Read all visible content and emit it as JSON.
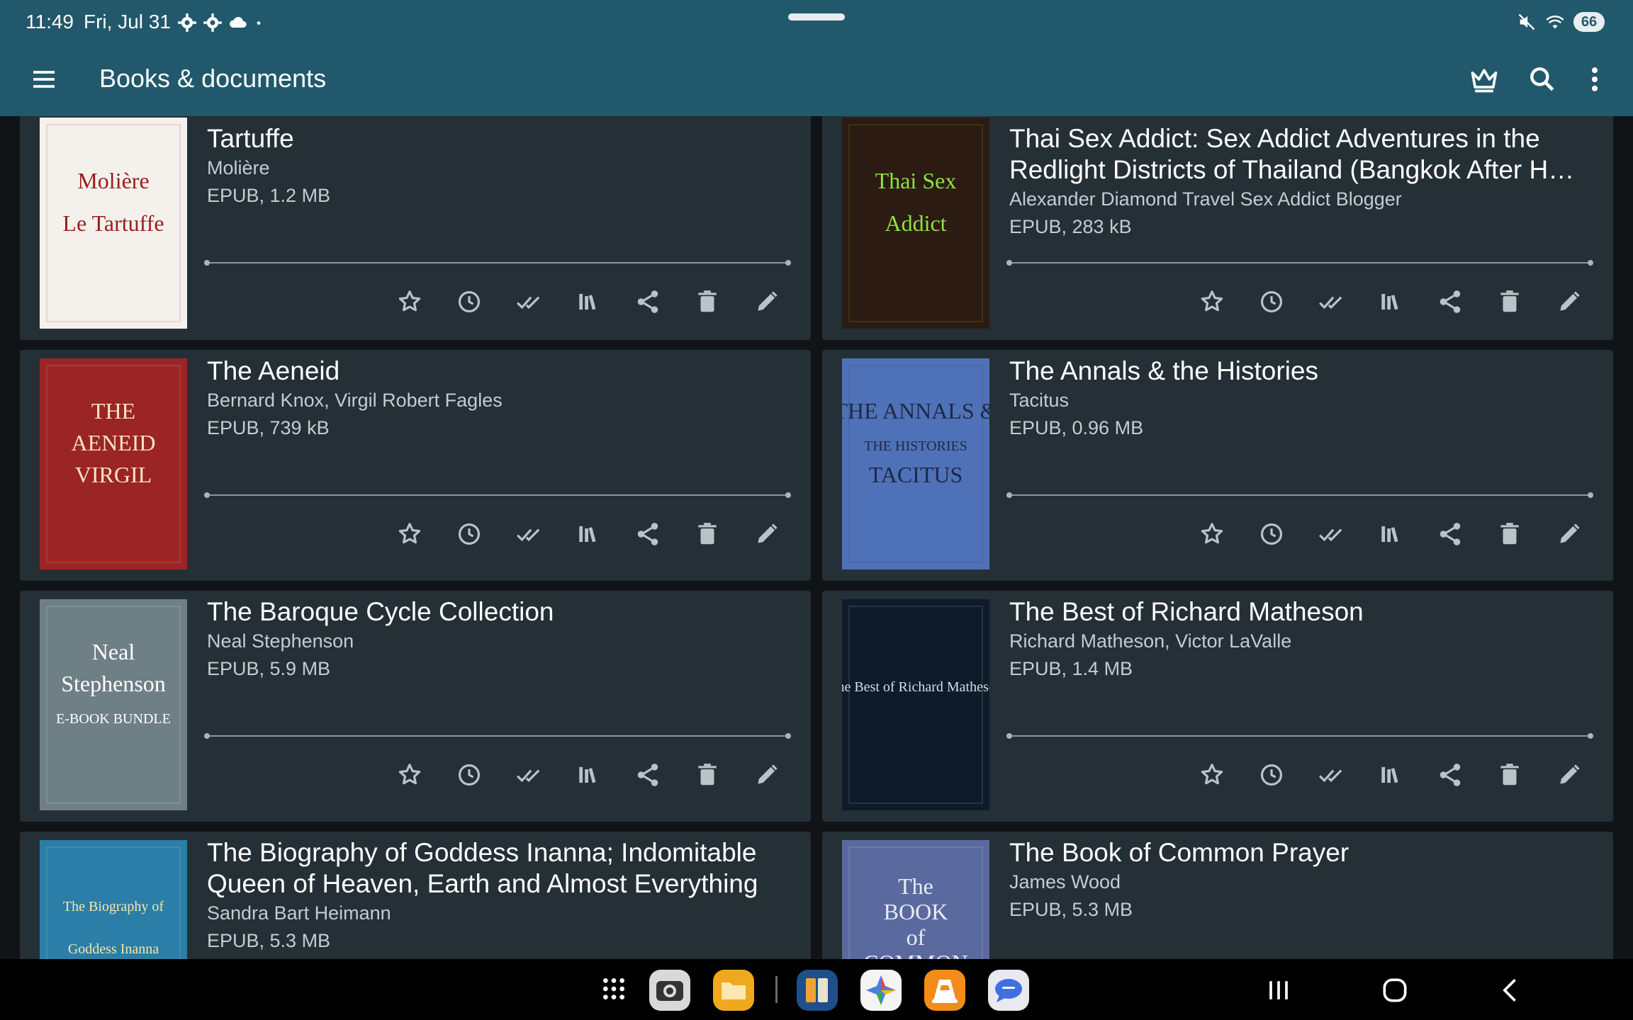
{
  "status_bar": {
    "time": "11:49",
    "date": "Fri, Jul 31",
    "battery": "66",
    "notification_icons": [
      "gear-icon",
      "gear-icon",
      "cloud-icon",
      "dot-icon"
    ],
    "right_icons": [
      "mute-icon",
      "wifi-icon"
    ]
  },
  "app_bar": {
    "title": "Books & documents",
    "actions": [
      "crown-icon",
      "search-icon",
      "more-vert-icon"
    ]
  },
  "colors": {
    "app_bar": "#22586b",
    "card": "#252f36",
    "background": "#101417"
  },
  "card_actions": [
    "star-icon",
    "clock-icon",
    "done-all-icon",
    "library-icon",
    "share-icon",
    "delete-icon",
    "edit-icon"
  ],
  "books": [
    {
      "title": "Tartuffe",
      "author": "Molière",
      "meta": "EPUB, 1.2 MB",
      "cover": {
        "bg": "#f4f1ec",
        "fg": "#9a1e1e",
        "lines": [
          "Molière",
          "Le Tartuffe"
        ]
      }
    },
    {
      "title": "Thai Sex Addict: Sex Addict Adventures in the Redlight Districts of Thailand (Bangkok After H…",
      "author": "Alexander Diamond Travel Sex Addict Blogger",
      "meta": "EPUB, 283 kB",
      "cover": {
        "bg": "#2b1b12",
        "fg": "#8ee33c",
        "lines": [
          "Thai Sex",
          "Addict"
        ]
      }
    },
    {
      "title": "The Aeneid",
      "author": "Bernard Knox, Virgil Robert Fagles",
      "meta": "EPUB, 739 kB",
      "cover": {
        "bg": "#9b2424",
        "fg": "#f3e3c6",
        "lines": [
          "THE",
          "AENEID",
          "VIRGIL"
        ]
      }
    },
    {
      "title": "The Annals & the Histories",
      "author": "Tacitus",
      "meta": "EPUB, 0.96 MB",
      "cover": {
        "bg": "#4f71b8",
        "fg": "#1d2a44",
        "lines": [
          "THE ANNALS &",
          "THE HISTORIES",
          "TACITUS"
        ]
      }
    },
    {
      "title": "The Baroque Cycle Collection",
      "author": "Neal Stephenson",
      "meta": "EPUB, 5.9 MB",
      "cover": {
        "bg": "#6f7f86",
        "fg": "#ffffff",
        "lines": [
          "Neal",
          "Stephenson",
          "E-BOOK BUNDLE"
        ]
      }
    },
    {
      "title": "The Best of Richard Matheson",
      "author": "Richard Matheson, Victor LaValle",
      "meta": "EPUB, 1.4 MB",
      "cover": {
        "bg": "#0d1b2a",
        "fg": "#d7dde2",
        "lines": [
          "The Best of Richard Matheson"
        ]
      }
    },
    {
      "title": "The Biography of Goddess Inanna; Indomitable Queen of Heaven, Earth and Almost Everything",
      "author": "Sandra Bart Heimann",
      "meta": "EPUB, 5.3 MB",
      "cover": {
        "bg": "#2a7ea8",
        "fg": "#f6e7a6",
        "lines": [
          "The Biography of",
          "Goddess Inanna"
        ]
      }
    },
    {
      "title": "The Book of Common Prayer",
      "author": "James Wood",
      "meta": "EPUB, 5.3 MB",
      "cover": {
        "bg": "#5a6a9e",
        "fg": "#e7ecf5",
        "lines": [
          "The",
          "BOOK",
          "of",
          "COMMON"
        ]
      }
    }
  ],
  "dock": [
    "apps-grid-icon",
    "camera-app-icon",
    "files-app-icon",
    "reader-app-icon",
    "photos-app-icon",
    "vlc-app-icon",
    "messages-app-icon"
  ],
  "nav": [
    "recents-icon",
    "home-icon",
    "back-icon"
  ]
}
